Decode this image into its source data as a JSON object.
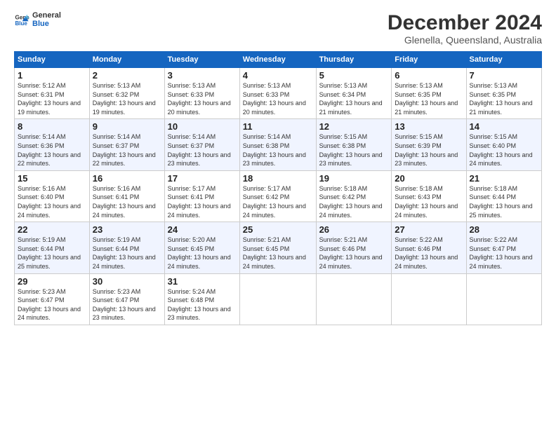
{
  "logo": {
    "line1": "General",
    "line2": "Blue"
  },
  "title": "December 2024",
  "subtitle": "Glenella, Queensland, Australia",
  "days_of_week": [
    "Sunday",
    "Monday",
    "Tuesday",
    "Wednesday",
    "Thursday",
    "Friday",
    "Saturday"
  ],
  "weeks": [
    [
      {
        "day": "1",
        "sunrise": "5:12 AM",
        "sunset": "6:31 PM",
        "daylight": "13 hours and 19 minutes."
      },
      {
        "day": "2",
        "sunrise": "5:13 AM",
        "sunset": "6:32 PM",
        "daylight": "13 hours and 19 minutes."
      },
      {
        "day": "3",
        "sunrise": "5:13 AM",
        "sunset": "6:33 PM",
        "daylight": "13 hours and 20 minutes."
      },
      {
        "day": "4",
        "sunrise": "5:13 AM",
        "sunset": "6:33 PM",
        "daylight": "13 hours and 20 minutes."
      },
      {
        "day": "5",
        "sunrise": "5:13 AM",
        "sunset": "6:34 PM",
        "daylight": "13 hours and 21 minutes."
      },
      {
        "day": "6",
        "sunrise": "5:13 AM",
        "sunset": "6:35 PM",
        "daylight": "13 hours and 21 minutes."
      },
      {
        "day": "7",
        "sunrise": "5:13 AM",
        "sunset": "6:35 PM",
        "daylight": "13 hours and 21 minutes."
      }
    ],
    [
      {
        "day": "8",
        "sunrise": "5:14 AM",
        "sunset": "6:36 PM",
        "daylight": "13 hours and 22 minutes."
      },
      {
        "day": "9",
        "sunrise": "5:14 AM",
        "sunset": "6:37 PM",
        "daylight": "13 hours and 22 minutes."
      },
      {
        "day": "10",
        "sunrise": "5:14 AM",
        "sunset": "6:37 PM",
        "daylight": "13 hours and 23 minutes."
      },
      {
        "day": "11",
        "sunrise": "5:14 AM",
        "sunset": "6:38 PM",
        "daylight": "13 hours and 23 minutes."
      },
      {
        "day": "12",
        "sunrise": "5:15 AM",
        "sunset": "6:38 PM",
        "daylight": "13 hours and 23 minutes."
      },
      {
        "day": "13",
        "sunrise": "5:15 AM",
        "sunset": "6:39 PM",
        "daylight": "13 hours and 23 minutes."
      },
      {
        "day": "14",
        "sunrise": "5:15 AM",
        "sunset": "6:40 PM",
        "daylight": "13 hours and 24 minutes."
      }
    ],
    [
      {
        "day": "15",
        "sunrise": "5:16 AM",
        "sunset": "6:40 PM",
        "daylight": "13 hours and 24 minutes."
      },
      {
        "day": "16",
        "sunrise": "5:16 AM",
        "sunset": "6:41 PM",
        "daylight": "13 hours and 24 minutes."
      },
      {
        "day": "17",
        "sunrise": "5:17 AM",
        "sunset": "6:41 PM",
        "daylight": "13 hours and 24 minutes."
      },
      {
        "day": "18",
        "sunrise": "5:17 AM",
        "sunset": "6:42 PM",
        "daylight": "13 hours and 24 minutes."
      },
      {
        "day": "19",
        "sunrise": "5:18 AM",
        "sunset": "6:42 PM",
        "daylight": "13 hours and 24 minutes."
      },
      {
        "day": "20",
        "sunrise": "5:18 AM",
        "sunset": "6:43 PM",
        "daylight": "13 hours and 24 minutes."
      },
      {
        "day": "21",
        "sunrise": "5:18 AM",
        "sunset": "6:44 PM",
        "daylight": "13 hours and 25 minutes."
      }
    ],
    [
      {
        "day": "22",
        "sunrise": "5:19 AM",
        "sunset": "6:44 PM",
        "daylight": "13 hours and 25 minutes."
      },
      {
        "day": "23",
        "sunrise": "5:19 AM",
        "sunset": "6:44 PM",
        "daylight": "13 hours and 24 minutes."
      },
      {
        "day": "24",
        "sunrise": "5:20 AM",
        "sunset": "6:45 PM",
        "daylight": "13 hours and 24 minutes."
      },
      {
        "day": "25",
        "sunrise": "5:21 AM",
        "sunset": "6:45 PM",
        "daylight": "13 hours and 24 minutes."
      },
      {
        "day": "26",
        "sunrise": "5:21 AM",
        "sunset": "6:46 PM",
        "daylight": "13 hours and 24 minutes."
      },
      {
        "day": "27",
        "sunrise": "5:22 AM",
        "sunset": "6:46 PM",
        "daylight": "13 hours and 24 minutes."
      },
      {
        "day": "28",
        "sunrise": "5:22 AM",
        "sunset": "6:47 PM",
        "daylight": "13 hours and 24 minutes."
      }
    ],
    [
      {
        "day": "29",
        "sunrise": "5:23 AM",
        "sunset": "6:47 PM",
        "daylight": "13 hours and 24 minutes."
      },
      {
        "day": "30",
        "sunrise": "5:23 AM",
        "sunset": "6:47 PM",
        "daylight": "13 hours and 23 minutes."
      },
      {
        "day": "31",
        "sunrise": "5:24 AM",
        "sunset": "6:48 PM",
        "daylight": "13 hours and 23 minutes."
      },
      null,
      null,
      null,
      null
    ]
  ]
}
